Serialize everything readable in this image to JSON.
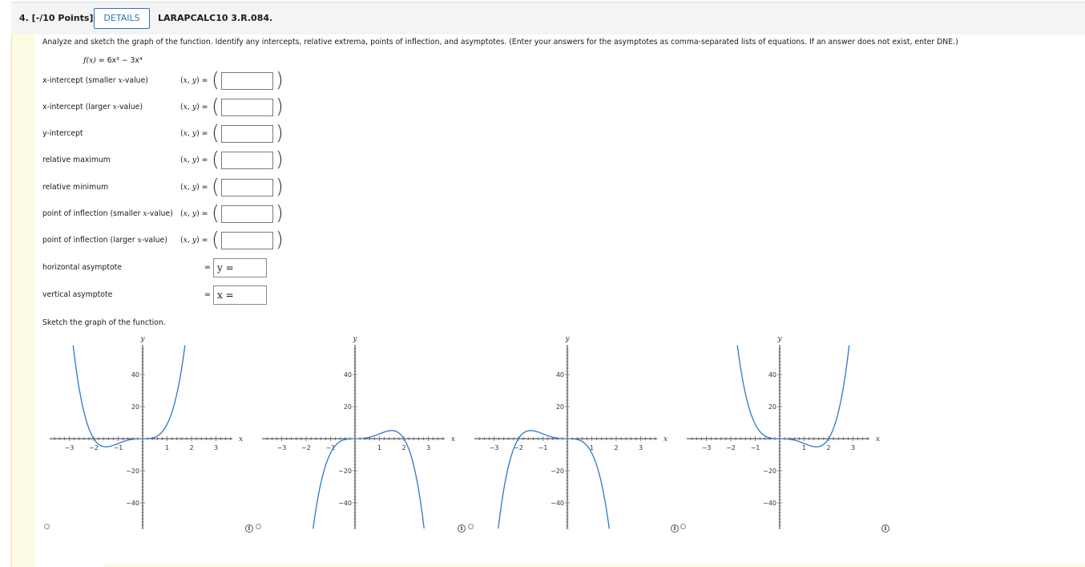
{
  "header": {
    "question_label": "4. [-/10 Points]",
    "details_button": "DETAILS",
    "question_id": "LARAPCALC10 3.R.084."
  },
  "instructions": "Analyze and sketch the graph of the function. Identify any intercepts, relative extrema, points of inflection, and asymptotes. (Enter your answers for the asymptotes as comma-separated lists of equations. If an answer does not exist, enter DNE.)",
  "function_lhs": "f(x)",
  "function_rhs": "= 6x³ − 3x⁴",
  "rows": [
    {
      "label_main": "x-intercept (smaller ",
      "label_var": "x",
      "label_end": "-value)",
      "xy": "(x, y) =",
      "value": ""
    },
    {
      "label_main": "x-intercept (larger ",
      "label_var": "x",
      "label_end": "-value)",
      "xy": "(x, y) =",
      "value": ""
    },
    {
      "label_main": "y-intercept",
      "label_var": "",
      "label_end": "",
      "xy": "(x, y) =",
      "value": ""
    },
    {
      "label_main": "relative maximum",
      "label_var": "",
      "label_end": "",
      "xy": "(x, y) =",
      "value": ""
    },
    {
      "label_main": "relative minimum",
      "label_var": "",
      "label_end": "",
      "xy": "(x, y) =",
      "value": ""
    },
    {
      "label_main": "point of inflection (smaller ",
      "label_var": "x",
      "label_end": "-value)",
      "xy": "(x, y) =",
      "value": ""
    },
    {
      "label_main": "point of inflection (larger ",
      "label_var": "x",
      "label_end": "-value)",
      "xy": "(x, y) =",
      "value": ""
    }
  ],
  "asymptotes": [
    {
      "label": "horizontal asymptote",
      "eq": "=",
      "prefix": "y =",
      "value": ""
    },
    {
      "label": "vertical asymptote",
      "eq": "=",
      "prefix": "x =",
      "value": ""
    }
  ],
  "sketch_label": "Sketch the graph of the function.",
  "graph_axis_labels": {
    "x": "x",
    "y": "y"
  },
  "graph_x_ticks": [
    "−3",
    "−2",
    "−1",
    "1",
    "2",
    "3"
  ],
  "graph_y_ticks": [
    "40",
    "20",
    "−20",
    "−40"
  ],
  "colors": {
    "curve": "#2a7ac4",
    "accent": "#2e74b8",
    "sidebar": "#fdfbe3"
  },
  "graph_options": [
    {
      "name": "option-a",
      "curve": "3x^4 + 6x^3",
      "selected": false
    },
    {
      "name": "option-b",
      "curve": "6x^3 - 3x^4",
      "selected": false
    },
    {
      "name": "option-c",
      "curve": "-3x^4 - 6x^3",
      "selected": false
    },
    {
      "name": "option-d",
      "curve": "3x^4 - 6x^3",
      "selected": false
    }
  ]
}
